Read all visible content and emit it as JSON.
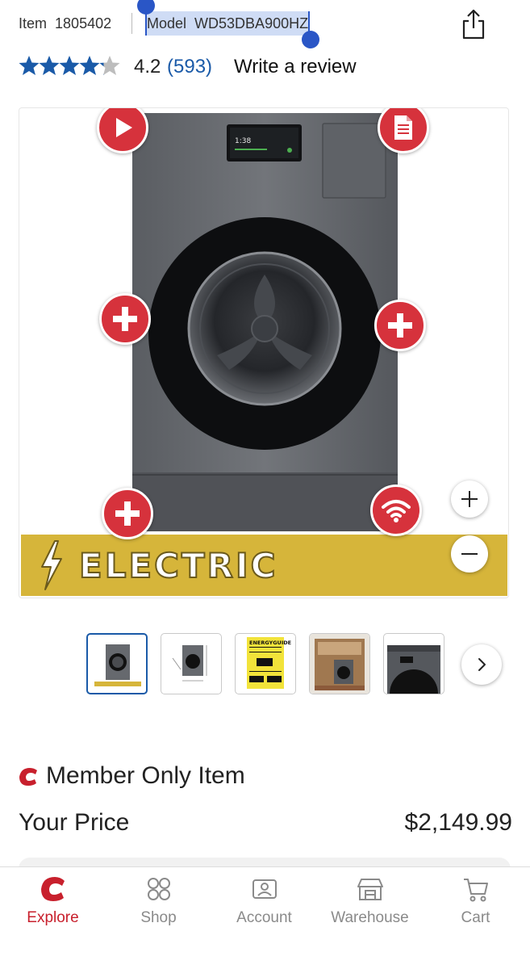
{
  "header": {
    "item_label": "Item",
    "item_number": "1805402",
    "model_label": "Model",
    "model_number": "WD53DBA900HZ",
    "share_icon": "share-icon"
  },
  "rating": {
    "stars_value": 4.2,
    "stars_max": 5,
    "score_text": "4.2",
    "count_text": "(593)",
    "write_review": "Write a review",
    "star_color": "#1a5aa8"
  },
  "gallery": {
    "banner_text": "ELECTRIC",
    "banner_color": "#d6b53a",
    "hotspot_color": "#d6323c",
    "hotspots": [
      {
        "name": "video-hotspot",
        "icon": "play-icon"
      },
      {
        "name": "document-hotspot",
        "icon": "document-icon"
      },
      {
        "name": "feature-hotspot-left",
        "icon": "plus-icon"
      },
      {
        "name": "feature-hotspot-right",
        "icon": "plus-icon"
      },
      {
        "name": "feature-hotspot-bottom",
        "icon": "plus-icon"
      },
      {
        "name": "wifi-hotspot",
        "icon": "wifi-icon"
      }
    ],
    "zoom_in_icon": "zoom-in-icon",
    "zoom_out_icon": "zoom-out-icon",
    "washer_screen_text": "1:38"
  },
  "thumbnails": {
    "items": [
      {
        "name": "washer-front-thumb",
        "active": true
      },
      {
        "name": "dimensions-thumb",
        "active": false
      },
      {
        "name": "energy-guide-thumb",
        "active": false,
        "label": "ENERGYGUIDE"
      },
      {
        "name": "lifestyle-thumb",
        "active": false
      },
      {
        "name": "washer-top-thumb",
        "active": false
      }
    ],
    "next_icon": "chevron-right-icon"
  },
  "member": {
    "text": "Member Only Item",
    "logo_color": "#c8202d"
  },
  "price": {
    "label": "Your Price",
    "value": "$2,149.99"
  },
  "tabbar": {
    "active_color": "#c8202d",
    "tabs": [
      {
        "label": "Explore",
        "icon": "explore-icon",
        "active": true
      },
      {
        "label": "Shop",
        "icon": "shop-icon",
        "active": false
      },
      {
        "label": "Account",
        "icon": "account-icon",
        "active": false
      },
      {
        "label": "Warehouse",
        "icon": "warehouse-icon",
        "active": false
      },
      {
        "label": "Cart",
        "icon": "cart-icon",
        "active": false
      }
    ]
  }
}
